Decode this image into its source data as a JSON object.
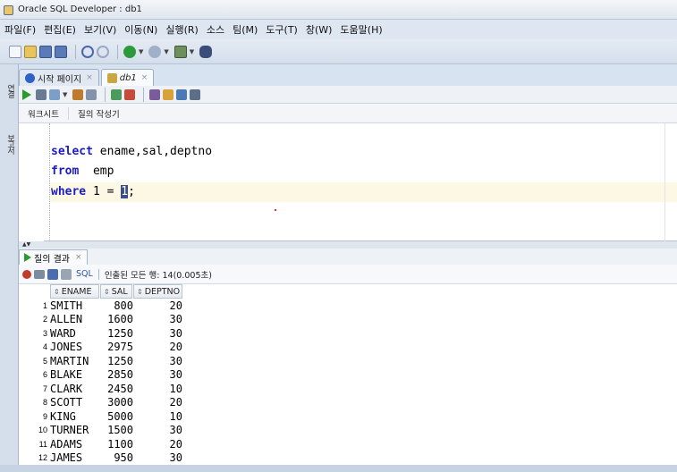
{
  "window": {
    "title": "Oracle SQL Developer : db1"
  },
  "menu": [
    "파일(F)",
    "편집(E)",
    "보기(V)",
    "이동(N)",
    "실행(R)",
    "소스",
    "팀(M)",
    "도구(T)",
    "창(W)",
    "도움말(H)"
  ],
  "doc_tabs": [
    {
      "label": "시작 페이지",
      "icon": "help-icon"
    },
    {
      "label": "db1",
      "icon": "db-connection-icon"
    }
  ],
  "left_strip": {
    "tab1": "연결",
    "tab2": "보고서"
  },
  "sub_tabs": [
    "워크시트",
    "질의 작성기"
  ],
  "editor": {
    "line1_kw": "select",
    "line1_rest": " ename,sal,deptno",
    "line2_kw": "from",
    "line2_rest": "  emp",
    "line3_kw": "where",
    "line3_rest": " 1 = ",
    "line3_sel": "1",
    "line3_end": ";"
  },
  "result": {
    "tab_label": "질의 결과",
    "sql_label": "SQL",
    "status": "인출된 모든 행: 14(0.005초)",
    "columns": [
      "ENAME",
      "SAL",
      "DEPTNO"
    ],
    "rows": [
      {
        "n": "1",
        "ename": "SMITH",
        "sal": "800",
        "deptno": "20"
      },
      {
        "n": "2",
        "ename": "ALLEN",
        "sal": "1600",
        "deptno": "30"
      },
      {
        "n": "3",
        "ename": "WARD",
        "sal": "1250",
        "deptno": "30"
      },
      {
        "n": "4",
        "ename": "JONES",
        "sal": "2975",
        "deptno": "20"
      },
      {
        "n": "5",
        "ename": "MARTIN",
        "sal": "1250",
        "deptno": "30"
      },
      {
        "n": "6",
        "ename": "BLAKE",
        "sal": "2850",
        "deptno": "30"
      },
      {
        "n": "7",
        "ename": "CLARK",
        "sal": "2450",
        "deptno": "10"
      },
      {
        "n": "8",
        "ename": "SCOTT",
        "sal": "3000",
        "deptno": "20"
      },
      {
        "n": "9",
        "ename": "KING",
        "sal": "5000",
        "deptno": "10"
      },
      {
        "n": "10",
        "ename": "TURNER",
        "sal": "1500",
        "deptno": "30"
      },
      {
        "n": "11",
        "ename": "ADAMS",
        "sal": "1100",
        "deptno": "20"
      },
      {
        "n": "12",
        "ename": "JAMES",
        "sal": "950",
        "deptno": "30"
      }
    ]
  }
}
